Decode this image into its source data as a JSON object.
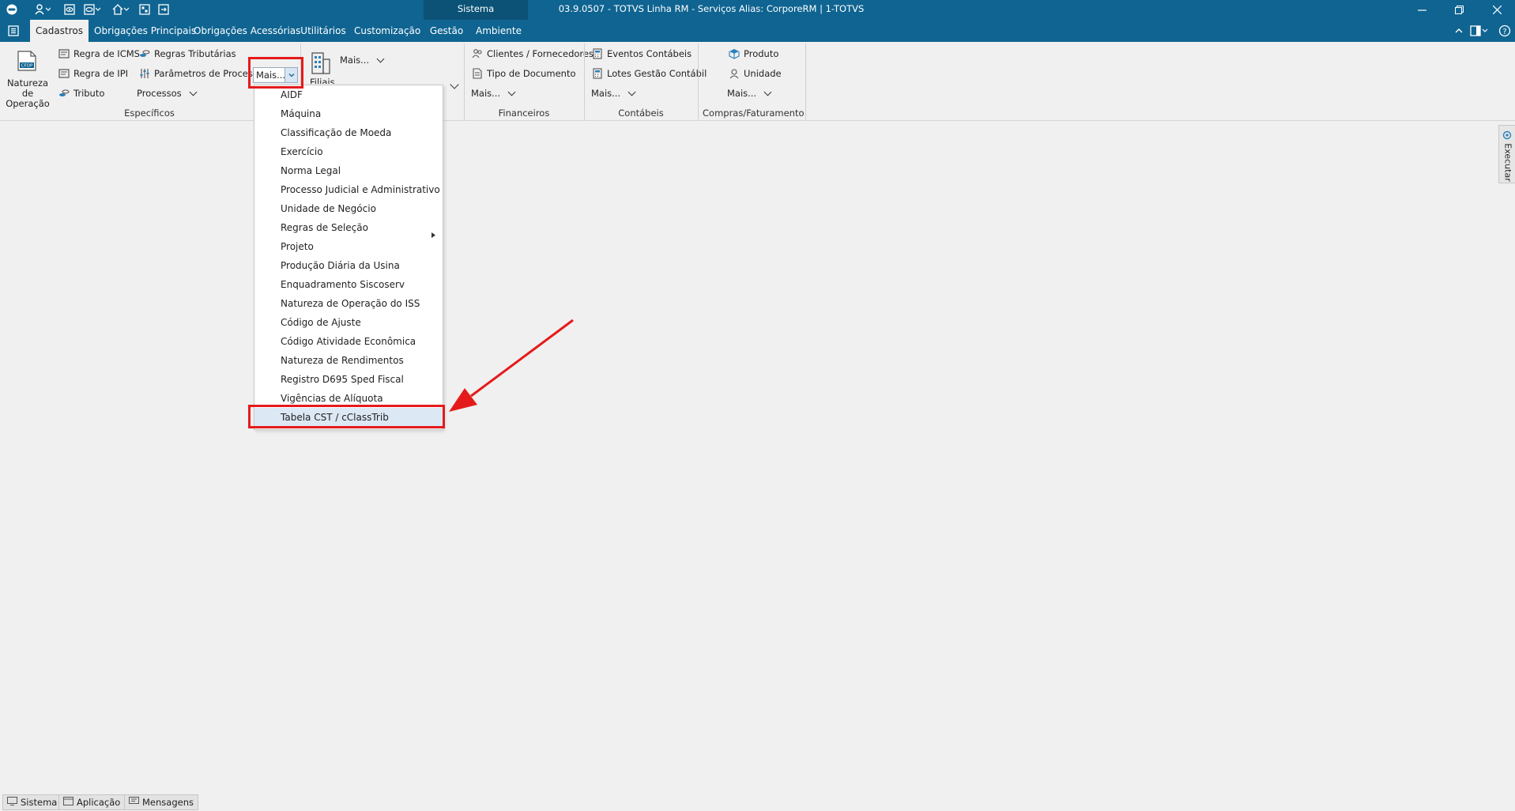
{
  "window": {
    "title": "03.9.0507 - TOTVS Linha RM - Serviços  Alias: CorporeRM | 1-TOTVS",
    "context_tab_label": "Sistema",
    "controls": [
      "minimize-icon",
      "restore-icon",
      "close-icon"
    ]
  },
  "quick_access": [
    "app-menu-icon",
    "user-icon",
    "eye-icon",
    "eye-settings-icon",
    "home-icon",
    "grid-icon",
    "logout-icon"
  ],
  "tabs": [
    {
      "label": "Cadastros",
      "active": true
    },
    {
      "label": "Obrigações Principais"
    },
    {
      "label": "Obrigações Acessórias"
    },
    {
      "label": "Utilitários"
    },
    {
      "label": "Customização"
    },
    {
      "label": "Gestão"
    },
    {
      "label": "Ambiente"
    }
  ],
  "ribbon": {
    "especificos": {
      "group_label": "Específicos",
      "natureza_label_1": "Natureza de",
      "natureza_label_2": "Operação",
      "natureza_icon_text": "CFOP",
      "items": [
        "Regra de ICMS",
        "Regra de IPI",
        "Tributo",
        "Regras Tributárias",
        "Parâmetros de Processos"
      ],
      "processos_label": "Processos",
      "mais_label": "Mais..."
    },
    "filiais": {
      "mais_label": "Mais...",
      "big_label_partial": "Filiais"
    },
    "financeiros": {
      "group_label": "Financeiros",
      "items": [
        "Clientes / Fornecedores",
        "Tipo de Documento"
      ],
      "mais_label": "Mais..."
    },
    "contabeis": {
      "group_label": "Contábeis",
      "items": [
        "Eventos Contábeis",
        "Lotes Gestão Contábil"
      ],
      "mais_label": "Mais..."
    },
    "compras": {
      "group_label": "Compras/Faturamento",
      "items": [
        "Produto",
        "Unidade"
      ],
      "mais_label": "Mais..."
    }
  },
  "dropdown_menu": {
    "items": [
      "AIDF",
      "Máquina",
      "Classificação de Moeda",
      "Exercício",
      "Norma Legal",
      "Processo Judicial e Administrativo",
      "Unidade de Negócio",
      "Regras de Seleção",
      "Projeto",
      "Produção Diária da Usina",
      "Enquadramento Siscoserv",
      "Natureza de Operação do ISS",
      "Código de Ajuste",
      "Código Atividade Econômica",
      "Natureza de Rendimentos",
      "Registro D695 Sped Fiscal",
      "Vigências de Alíquota",
      "Tabela CST / cClassTrib"
    ],
    "submenu_item": "Regras de Seleção",
    "highlighted_item": "Tabela CST / cClassTrib"
  },
  "side_panel": {
    "label": "Executar"
  },
  "status_bar": [
    "Sistema",
    "Aplicação",
    "Mensagens"
  ],
  "annotation_color": "#e51b1b",
  "accent_color": "#0f6491"
}
